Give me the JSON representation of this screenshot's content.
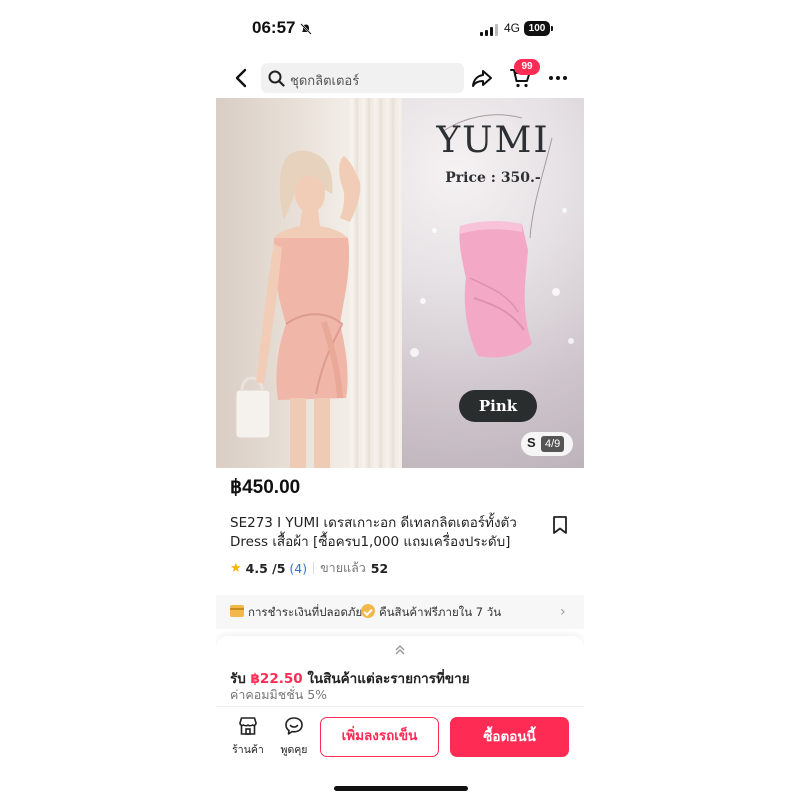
{
  "status_bar": {
    "time": "06:57",
    "network": "4G",
    "battery": "100"
  },
  "header": {
    "search_text": "ชุดกลิตเตอร์",
    "cart_badge": "99",
    "icons": [
      "back-arrow-icon",
      "search-icon",
      "share-icon",
      "cart-icon",
      "more-icon"
    ]
  },
  "gallery": {
    "brand": "YUMI",
    "price_tag": "Price : 350.-",
    "color_label": "Pink",
    "size_prefix": "S",
    "counter": "4/9"
  },
  "product": {
    "price": "฿450.00",
    "title": "SE273 I YUMI เดรสเกาะอก ดีเทลกลิตเตอร์ทั้งตัว Dress เสื้อผ้า [ซื้อครบ1,000 แถมเครื่องประดับ]",
    "rating": "4.5 /5",
    "rating_count": "(4)",
    "sold_label": "ขายแล้ว",
    "sold_count": "52"
  },
  "services": {
    "payment": "การชำระเงินที่ปลอดภัย",
    "returns": "คืนสินค้าฟรีภายใน 7 วัน"
  },
  "commission": {
    "prefix": "รับ",
    "amount": "฿22.50",
    "suffix": "ในสินค้าแต่ละรายการที่ขาย",
    "rate": "ค่าคอมมิชชั่น 5%"
  },
  "bottom_bar": {
    "shop_label": "ร้านค้า",
    "chat_label": "พูดคุย",
    "add_to_cart": "เพิ่มลงรถเข็น",
    "buy_now": "ซื้อตอนนี้"
  },
  "colors": {
    "accent": "#fe2c55",
    "star": "#f6b500",
    "link": "#3a6fd1"
  }
}
